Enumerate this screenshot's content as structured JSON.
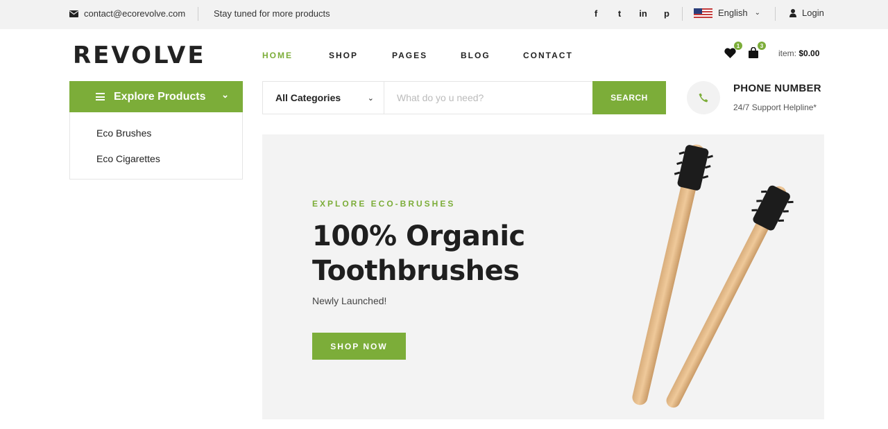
{
  "topbar": {
    "email": "contact@ecorevolve.com",
    "tagline": "Stay tuned for more products",
    "social": [
      "f",
      "t",
      "in",
      "p"
    ],
    "language": "English",
    "login": "Login"
  },
  "header": {
    "logo": "REVOLVE",
    "nav": [
      {
        "label": "HOME",
        "active": true
      },
      {
        "label": "SHOP",
        "active": false
      },
      {
        "label": "PAGES",
        "active": false
      },
      {
        "label": "BLOG",
        "active": false
      },
      {
        "label": "CONTACT",
        "active": false
      }
    ],
    "wishlist_count": "1",
    "cart_count": "3",
    "cart_label": "item:",
    "cart_total": "$0.00"
  },
  "sidebar": {
    "title": "Explore Products",
    "items": [
      {
        "label": "Eco Brushes"
      },
      {
        "label": "Eco Cigarettes"
      }
    ]
  },
  "search": {
    "category": "All Categories",
    "placeholder": "What do yo u need?",
    "button": "SEARCH"
  },
  "phone": {
    "title": "PHONE NUMBER",
    "subtitle": "24/7 Support Helpline*"
  },
  "hero": {
    "eyebrow": "EXPLORE ECO-BRUSHES",
    "title_line1": "100% Organic",
    "title_line2": "Toothbrushes",
    "subtitle": "Newly Launched!",
    "button": "SHOP NOW"
  },
  "colors": {
    "accent": "#7cad39",
    "topbar_bg": "#f2f2f2",
    "hero_bg": "#f3f3f3"
  }
}
